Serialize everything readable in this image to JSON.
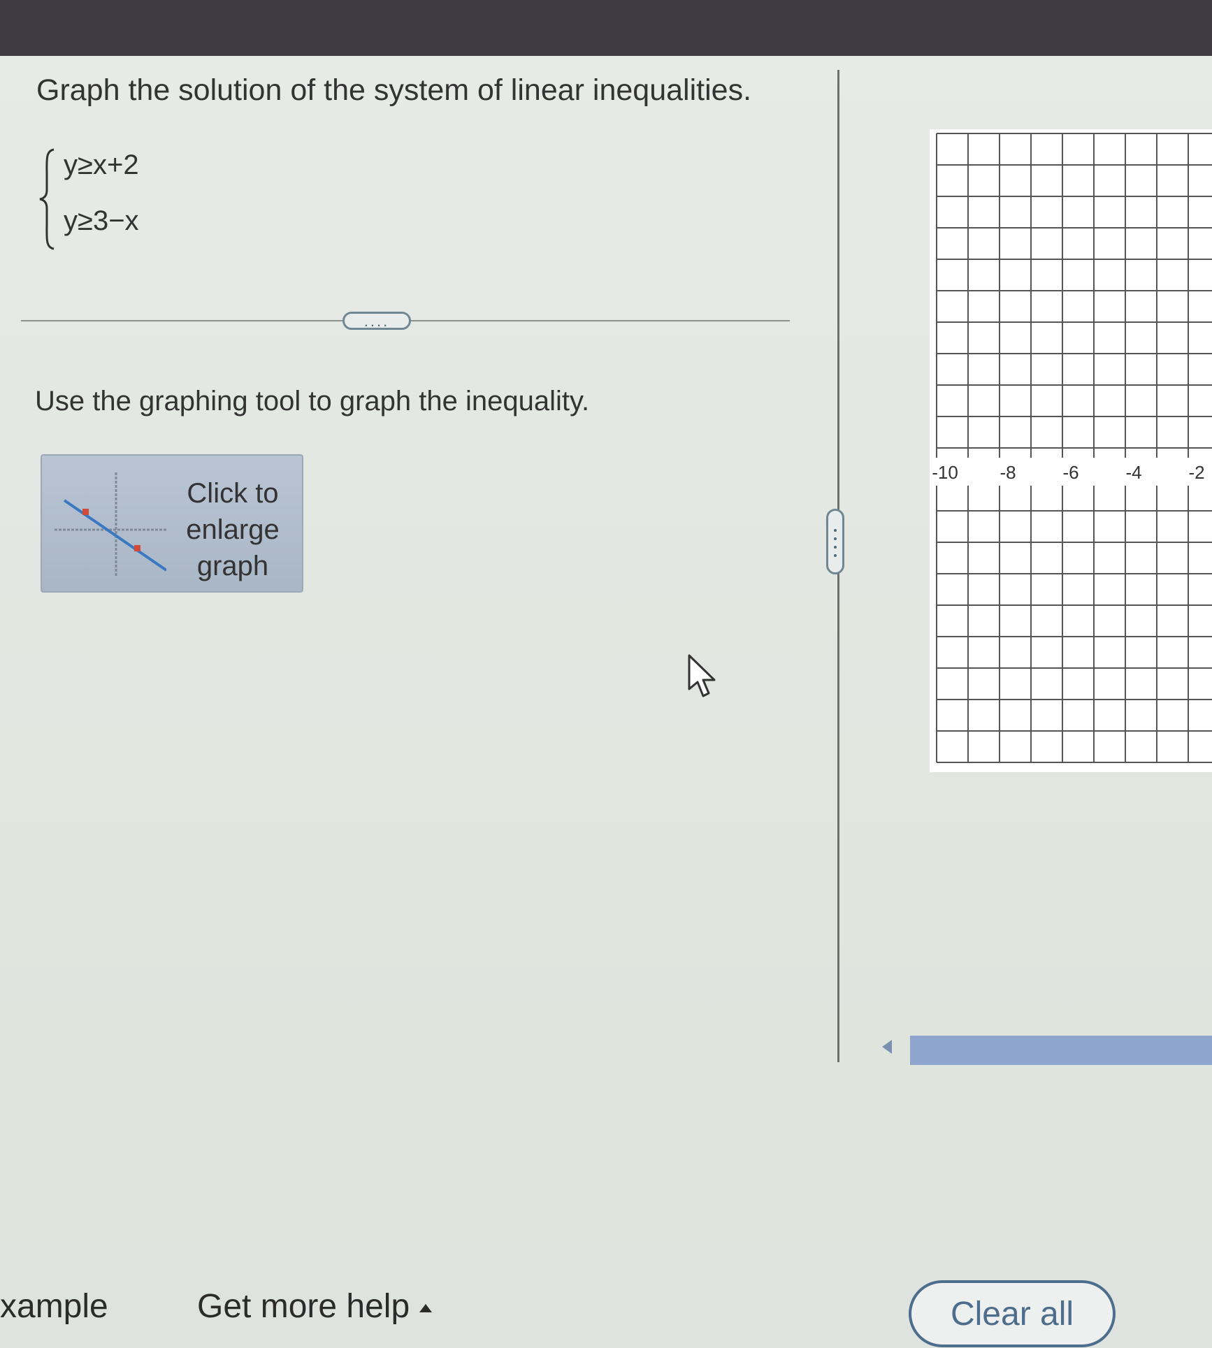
{
  "problem": {
    "title": "Graph the solution of the system of linear inequalities.",
    "inequalities": [
      "y≥x+2",
      "y≥3−x"
    ]
  },
  "instruction": "Use the graphing tool to graph the inequality.",
  "enlarge_button": {
    "line1": "Click to",
    "line2": "enlarge",
    "line3": "graph",
    "icon": "graph-thumbnail-icon"
  },
  "divider_handle": "....",
  "graph": {
    "x_tick_labels": [
      "-10",
      "-8",
      "-6",
      "-4",
      "-2"
    ],
    "grid": true
  },
  "footer": {
    "example_label": "xample",
    "help_label": "Get more help",
    "clear_label": "Clear all"
  },
  "colors": {
    "accent": "#4d6d8c",
    "button_bg": "#b4c1d1",
    "scrollbar": "#8ea6cd",
    "thumb_line_blue": "#3a78c2",
    "thumb_point_red": "#d04a3a"
  }
}
